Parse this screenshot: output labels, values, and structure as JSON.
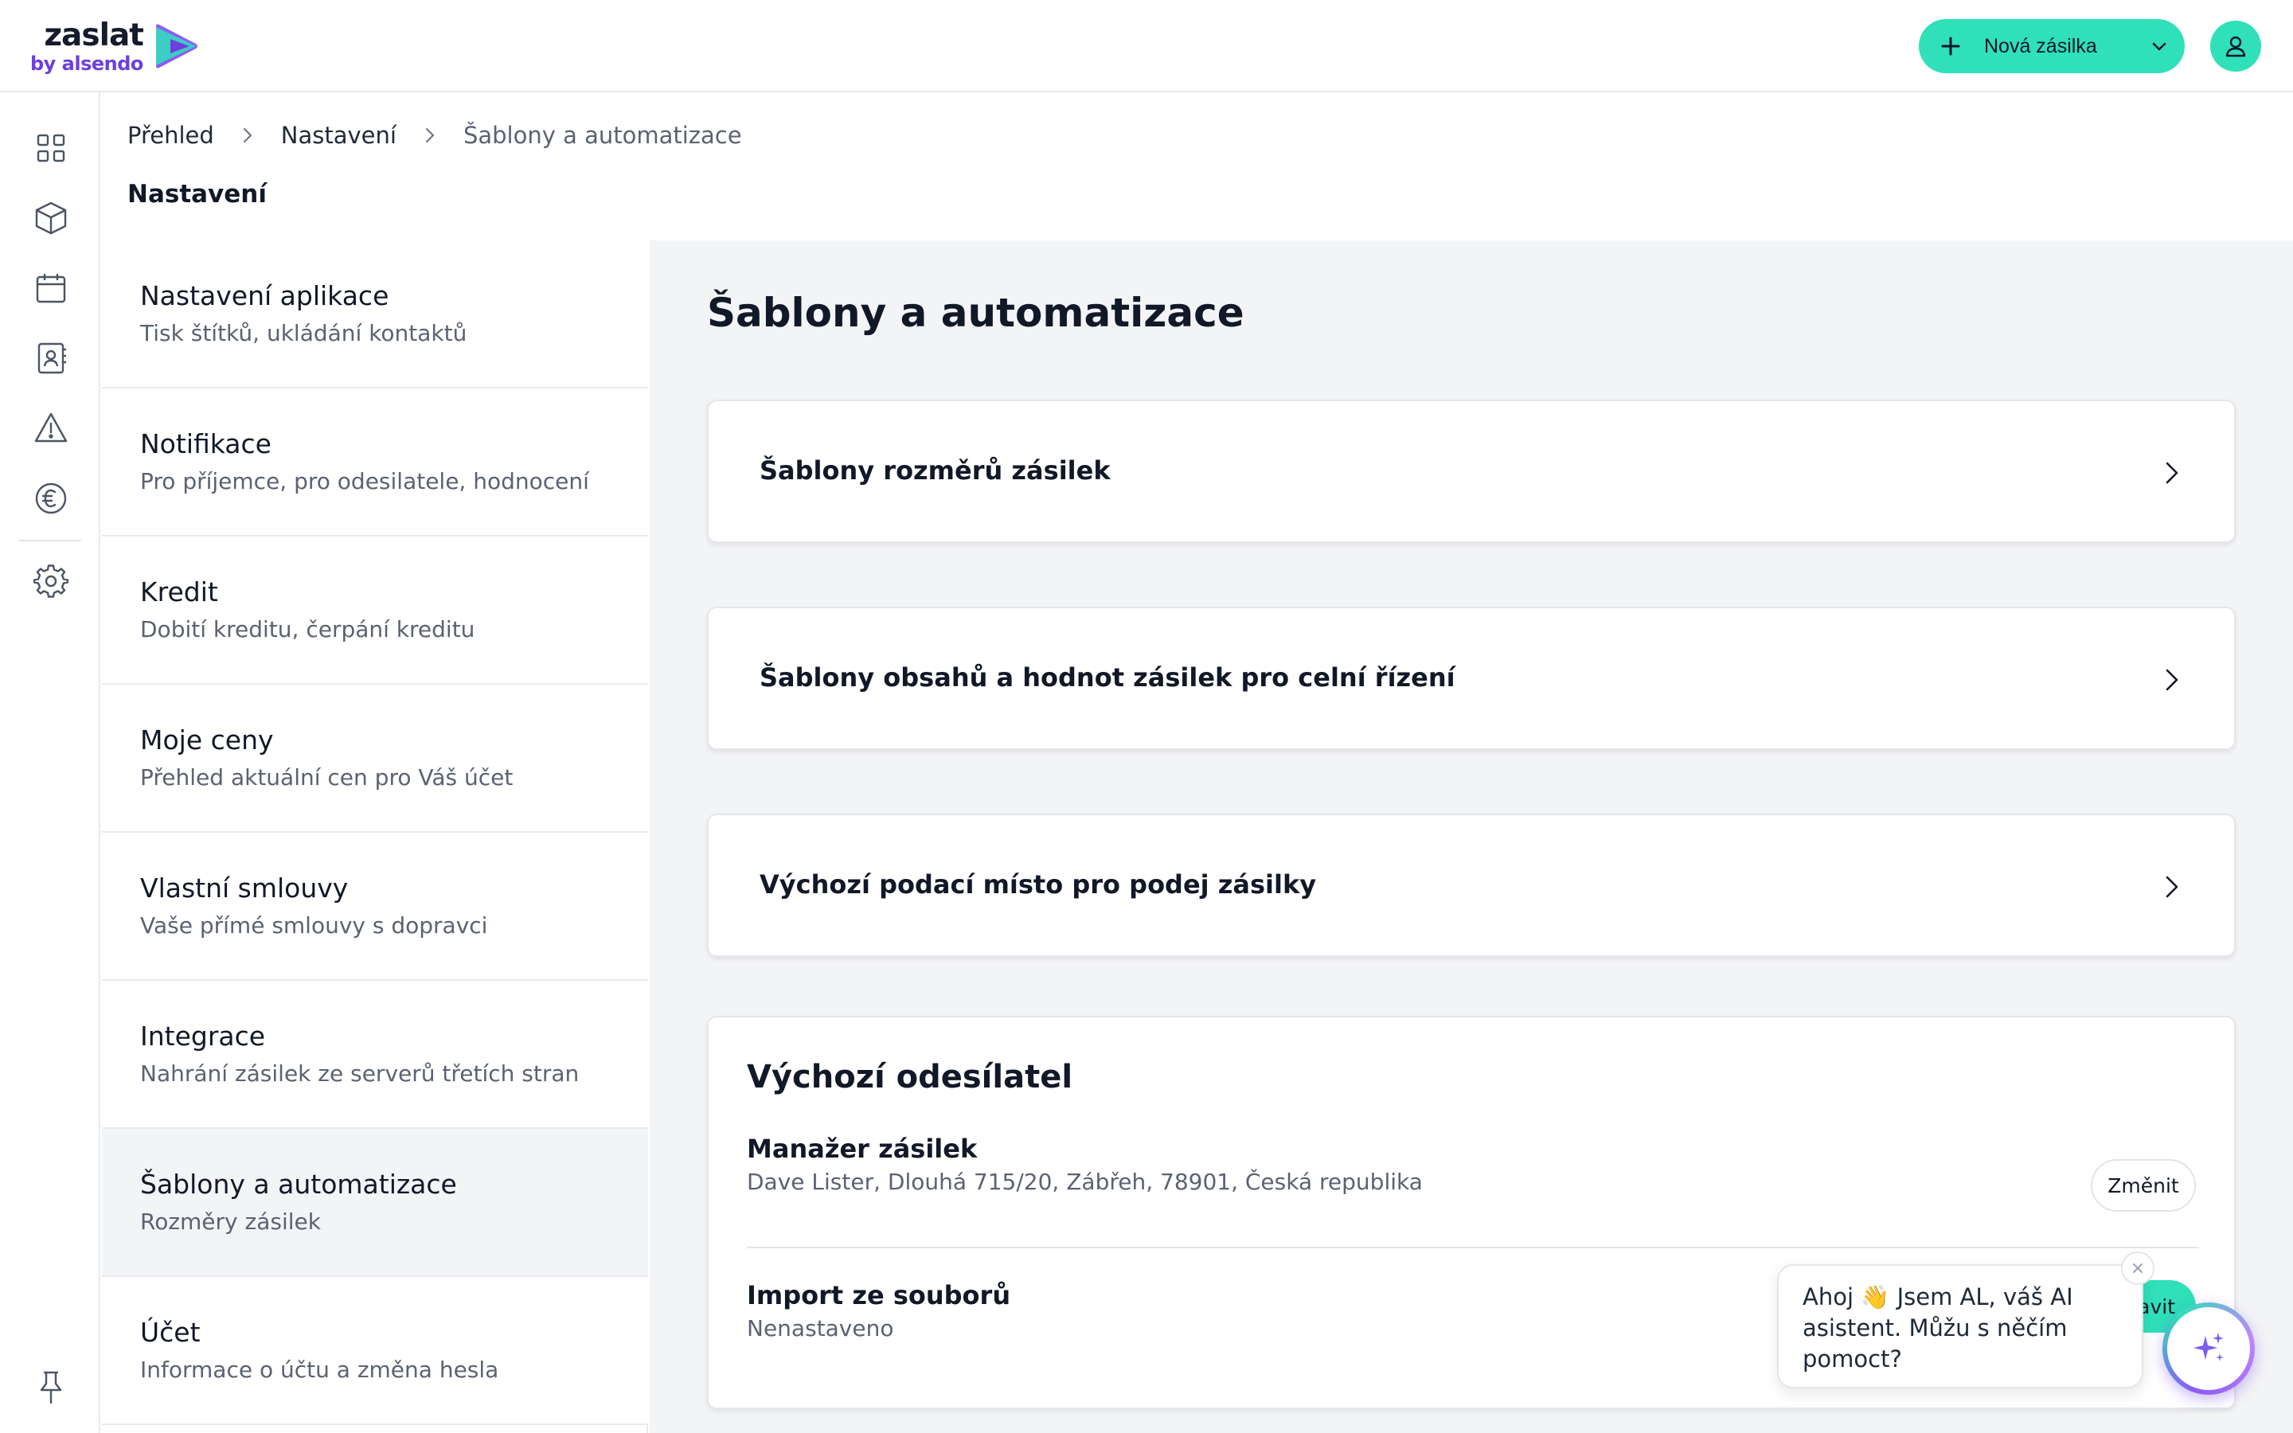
{
  "brand": {
    "name": "zaslat",
    "sub": "by alsendo",
    "accent": "#2fe0b8",
    "purple": "#6d3fe0"
  },
  "header": {
    "new_shipment_label": "Nová zásilka",
    "user_icon": "user-icon"
  },
  "rail": {
    "items": [
      "dashboard-icon",
      "package-icon",
      "calendar-icon",
      "contacts-icon",
      "warning-icon",
      "euro-icon",
      "settings-icon"
    ],
    "bottom": "pin-icon"
  },
  "breadcrumb": {
    "items": [
      "Přehled",
      "Nastavení",
      "Šablony a automatizace"
    ]
  },
  "page_title": "Nastavení",
  "menu": {
    "items": [
      {
        "title": "Nastavení aplikace",
        "subtitle": "Tisk štítků, ukládání kontaktů"
      },
      {
        "title": "Notifikace",
        "subtitle": "Pro příjemce, pro odesilatele, hodnocení"
      },
      {
        "title": "Kredit",
        "subtitle": "Dobití kreditu, čerpání kreditu"
      },
      {
        "title": "Moje ceny",
        "subtitle": "Přehled aktuální cen pro Váš účet"
      },
      {
        "title": "Vlastní smlouvy",
        "subtitle": "Vaše přímé smlouvy s dopravci"
      },
      {
        "title": "Integrace",
        "subtitle": "Nahrání zásilek ze serverů třetích stran"
      },
      {
        "title": "Šablony a automatizace",
        "subtitle": "Rozměry zásilek"
      },
      {
        "title": "Účet",
        "subtitle": "Informace o účtu a změna hesla"
      }
    ],
    "active_index": 6
  },
  "main": {
    "title": "Šablony a automatizace",
    "link_cards": [
      {
        "title": "Šablony rozměrů zásilek"
      },
      {
        "title": "Šablony obsahů a hodnot zásilek pro celní řízení"
      },
      {
        "title": "Výchozí podací místo pro podej zásilky"
      }
    ],
    "default_sender": {
      "title": "Výchozí odesílatel",
      "rows": [
        {
          "title": "Manažer zásilek",
          "subtitle": "Dave Lister, Dlouhá 715/20, Zábřeh, 78901, Česká republika",
          "button": "Změnit"
        },
        {
          "title": "Import ze souborů",
          "subtitle": "Nenastaveno",
          "button": "Nastavit"
        }
      ]
    }
  },
  "chat": {
    "message": "Ahoj 👋 Jsem AL, váš AI asistent. Můžu s něčím pomoct?",
    "fab_icon": "sparkles-icon"
  }
}
